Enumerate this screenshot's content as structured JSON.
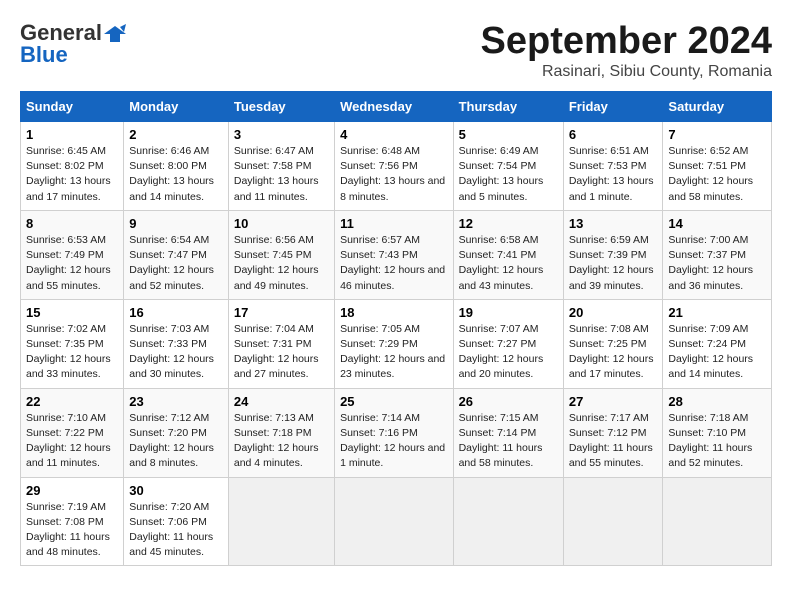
{
  "header": {
    "logo_line1": "General",
    "logo_line2": "Blue",
    "title": "September 2024",
    "subtitle": "Rasinari, Sibiu County, Romania"
  },
  "calendar": {
    "headers": [
      "Sunday",
      "Monday",
      "Tuesday",
      "Wednesday",
      "Thursday",
      "Friday",
      "Saturday"
    ],
    "rows": [
      [
        {
          "day": "1",
          "info": "Sunrise: 6:45 AM\nSunset: 8:02 PM\nDaylight: 13 hours and 17 minutes."
        },
        {
          "day": "2",
          "info": "Sunrise: 6:46 AM\nSunset: 8:00 PM\nDaylight: 13 hours and 14 minutes."
        },
        {
          "day": "3",
          "info": "Sunrise: 6:47 AM\nSunset: 7:58 PM\nDaylight: 13 hours and 11 minutes."
        },
        {
          "day": "4",
          "info": "Sunrise: 6:48 AM\nSunset: 7:56 PM\nDaylight: 13 hours and 8 minutes."
        },
        {
          "day": "5",
          "info": "Sunrise: 6:49 AM\nSunset: 7:54 PM\nDaylight: 13 hours and 5 minutes."
        },
        {
          "day": "6",
          "info": "Sunrise: 6:51 AM\nSunset: 7:53 PM\nDaylight: 13 hours and 1 minute."
        },
        {
          "day": "7",
          "info": "Sunrise: 6:52 AM\nSunset: 7:51 PM\nDaylight: 12 hours and 58 minutes."
        }
      ],
      [
        {
          "day": "8",
          "info": "Sunrise: 6:53 AM\nSunset: 7:49 PM\nDaylight: 12 hours and 55 minutes."
        },
        {
          "day": "9",
          "info": "Sunrise: 6:54 AM\nSunset: 7:47 PM\nDaylight: 12 hours and 52 minutes."
        },
        {
          "day": "10",
          "info": "Sunrise: 6:56 AM\nSunset: 7:45 PM\nDaylight: 12 hours and 49 minutes."
        },
        {
          "day": "11",
          "info": "Sunrise: 6:57 AM\nSunset: 7:43 PM\nDaylight: 12 hours and 46 minutes."
        },
        {
          "day": "12",
          "info": "Sunrise: 6:58 AM\nSunset: 7:41 PM\nDaylight: 12 hours and 43 minutes."
        },
        {
          "day": "13",
          "info": "Sunrise: 6:59 AM\nSunset: 7:39 PM\nDaylight: 12 hours and 39 minutes."
        },
        {
          "day": "14",
          "info": "Sunrise: 7:00 AM\nSunset: 7:37 PM\nDaylight: 12 hours and 36 minutes."
        }
      ],
      [
        {
          "day": "15",
          "info": "Sunrise: 7:02 AM\nSunset: 7:35 PM\nDaylight: 12 hours and 33 minutes."
        },
        {
          "day": "16",
          "info": "Sunrise: 7:03 AM\nSunset: 7:33 PM\nDaylight: 12 hours and 30 minutes."
        },
        {
          "day": "17",
          "info": "Sunrise: 7:04 AM\nSunset: 7:31 PM\nDaylight: 12 hours and 27 minutes."
        },
        {
          "day": "18",
          "info": "Sunrise: 7:05 AM\nSunset: 7:29 PM\nDaylight: 12 hours and 23 minutes."
        },
        {
          "day": "19",
          "info": "Sunrise: 7:07 AM\nSunset: 7:27 PM\nDaylight: 12 hours and 20 minutes."
        },
        {
          "day": "20",
          "info": "Sunrise: 7:08 AM\nSunset: 7:25 PM\nDaylight: 12 hours and 17 minutes."
        },
        {
          "day": "21",
          "info": "Sunrise: 7:09 AM\nSunset: 7:24 PM\nDaylight: 12 hours and 14 minutes."
        }
      ],
      [
        {
          "day": "22",
          "info": "Sunrise: 7:10 AM\nSunset: 7:22 PM\nDaylight: 12 hours and 11 minutes."
        },
        {
          "day": "23",
          "info": "Sunrise: 7:12 AM\nSunset: 7:20 PM\nDaylight: 12 hours and 8 minutes."
        },
        {
          "day": "24",
          "info": "Sunrise: 7:13 AM\nSunset: 7:18 PM\nDaylight: 12 hours and 4 minutes."
        },
        {
          "day": "25",
          "info": "Sunrise: 7:14 AM\nSunset: 7:16 PM\nDaylight: 12 hours and 1 minute."
        },
        {
          "day": "26",
          "info": "Sunrise: 7:15 AM\nSunset: 7:14 PM\nDaylight: 11 hours and 58 minutes."
        },
        {
          "day": "27",
          "info": "Sunrise: 7:17 AM\nSunset: 7:12 PM\nDaylight: 11 hours and 55 minutes."
        },
        {
          "day": "28",
          "info": "Sunrise: 7:18 AM\nSunset: 7:10 PM\nDaylight: 11 hours and 52 minutes."
        }
      ],
      [
        {
          "day": "29",
          "info": "Sunrise: 7:19 AM\nSunset: 7:08 PM\nDaylight: 11 hours and 48 minutes."
        },
        {
          "day": "30",
          "info": "Sunrise: 7:20 AM\nSunset: 7:06 PM\nDaylight: 11 hours and 45 minutes."
        },
        {
          "day": "",
          "info": ""
        },
        {
          "day": "",
          "info": ""
        },
        {
          "day": "",
          "info": ""
        },
        {
          "day": "",
          "info": ""
        },
        {
          "day": "",
          "info": ""
        }
      ]
    ]
  }
}
